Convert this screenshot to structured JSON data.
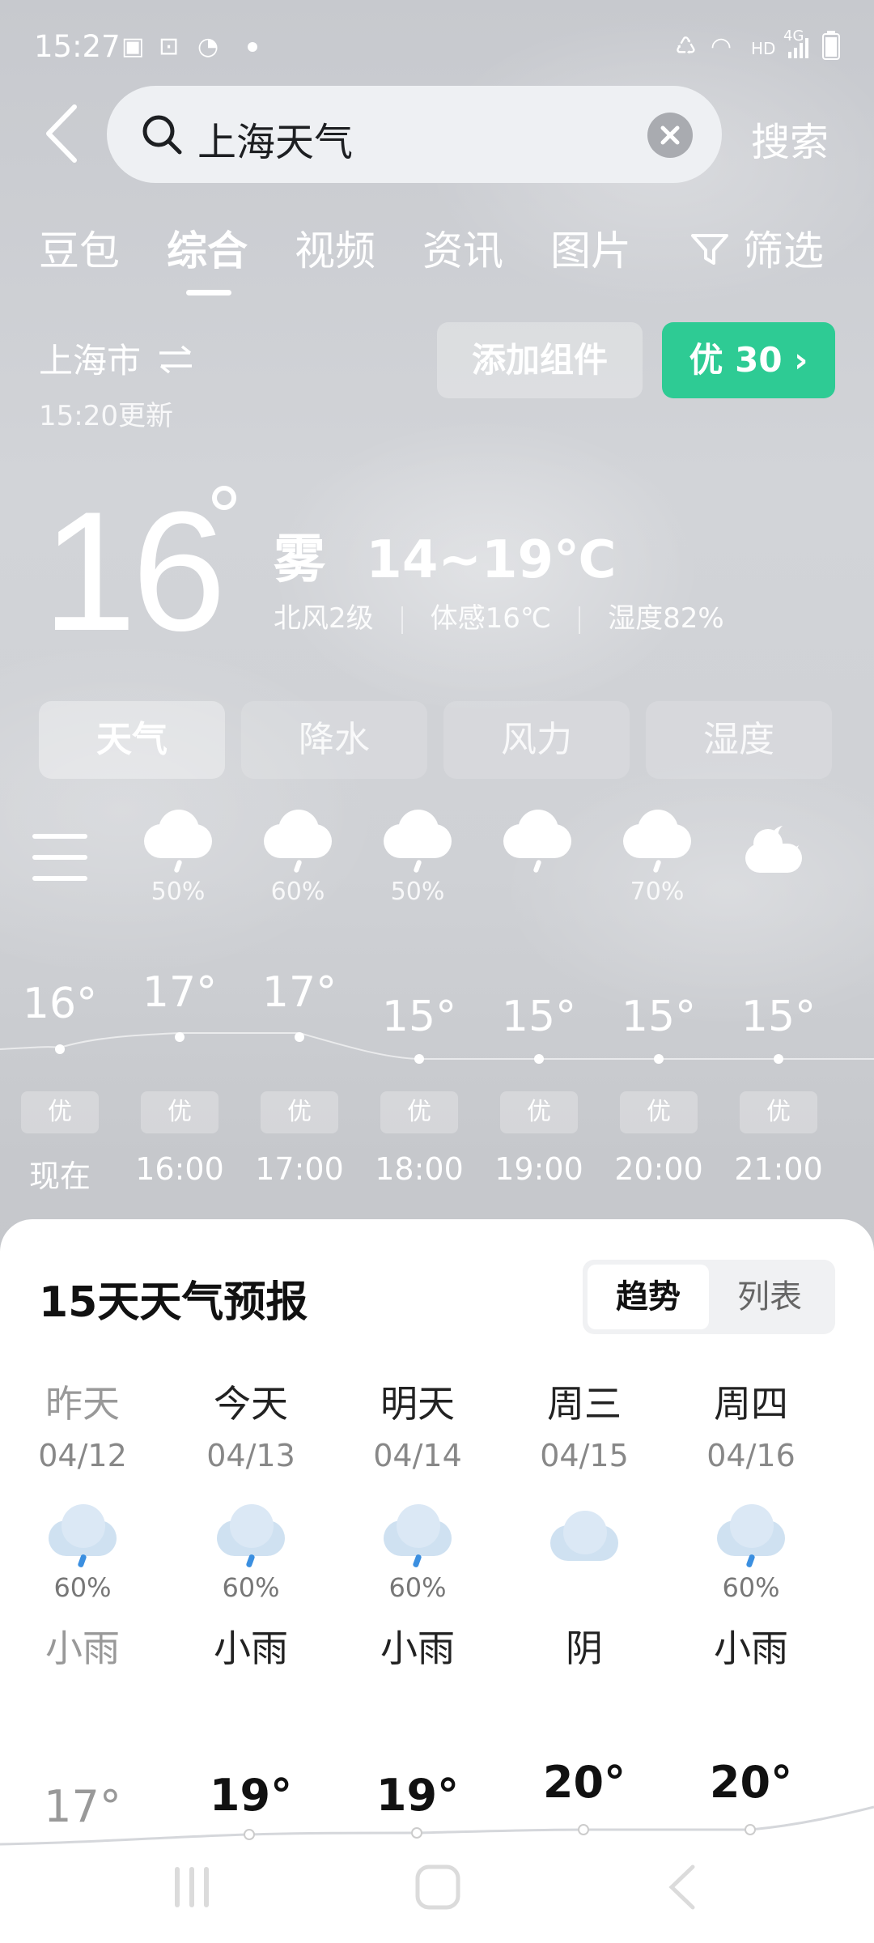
{
  "status_bar": {
    "time": "15:27",
    "network": "4G",
    "hd_label": "HD"
  },
  "search": {
    "query": "上海天气",
    "submit_label": "搜索"
  },
  "tabs": [
    "豆包",
    "综合",
    "视频",
    "资讯",
    "图片",
    "筛选"
  ],
  "active_tab": "综合",
  "location": {
    "city": "上海市",
    "updated": "15:20更新"
  },
  "actions": {
    "add_widget": "添加组件",
    "aqi_label": "优 30 ›"
  },
  "current": {
    "temp": "16",
    "condition": "雾",
    "range": "14~19℃",
    "wind": "北风2级",
    "feels_like": "体感16℃",
    "humidity": "湿度82%"
  },
  "metric_tabs": [
    "天气",
    "降水",
    "风力",
    "湿度"
  ],
  "hourly": [
    {
      "time": "现在",
      "temp": "16°",
      "aqi": "优",
      "pct": "",
      "icon": "menu-icon"
    },
    {
      "time": "16:00",
      "temp": "17°",
      "aqi": "优",
      "pct": "50%",
      "icon": "rain-cloud-icon"
    },
    {
      "time": "17:00",
      "temp": "17°",
      "aqi": "优",
      "pct": "60%",
      "icon": "rain-cloud-icon"
    },
    {
      "time": "18:00",
      "temp": "15°",
      "aqi": "优",
      "pct": "50%",
      "icon": "rain-cloud-icon"
    },
    {
      "time": "19:00",
      "temp": "15°",
      "aqi": "优",
      "pct": "",
      "icon": "rain-cloud-icon"
    },
    {
      "time": "20:00",
      "temp": "15°",
      "aqi": "优",
      "pct": "70%",
      "icon": "rain-cloud-icon"
    },
    {
      "time": "21:00",
      "temp": "15°",
      "aqi": "优",
      "pct": "",
      "icon": "cloudy-night-icon"
    }
  ],
  "forecast": {
    "title": "15天天气预报",
    "view_options": [
      "趋势",
      "列表"
    ],
    "days": [
      {
        "name": "昨天",
        "date": "04/12",
        "pct": "60%",
        "condition": "小雨",
        "high": "17°",
        "icon": "rain-cloud-icon"
      },
      {
        "name": "今天",
        "date": "04/13",
        "pct": "60%",
        "condition": "小雨",
        "high": "19°",
        "icon": "rain-cloud-icon"
      },
      {
        "name": "明天",
        "date": "04/14",
        "pct": "60%",
        "condition": "小雨",
        "high": "19°",
        "icon": "rain-cloud-icon"
      },
      {
        "name": "周三",
        "date": "04/15",
        "pct": "",
        "condition": "阴",
        "high": "20°",
        "icon": "overcast-icon"
      },
      {
        "name": "周四",
        "date": "04/16",
        "pct": "60%",
        "condition": "小雨",
        "high": "20°",
        "icon": "rain-cloud-icon"
      }
    ]
  },
  "colors": {
    "aqi_green": "#2ecb94",
    "rain_blue": "#3b8fe0"
  }
}
